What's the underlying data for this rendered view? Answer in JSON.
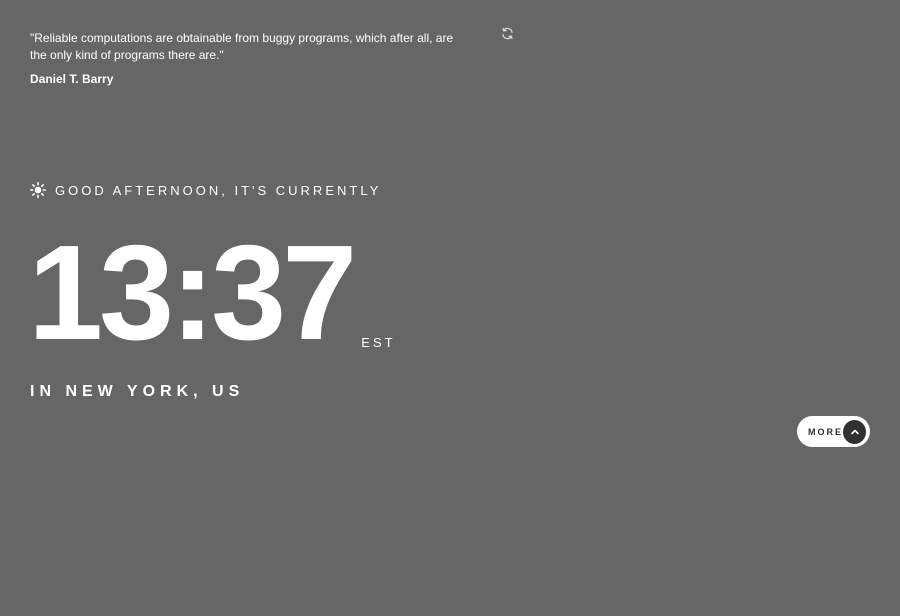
{
  "quote": {
    "text": "\"Reliable computations are obtainable from buggy programs, which after all, are the only kind of programs there are.\"",
    "author": "Daniel T. Barry",
    "refresh_icon": "refresh-icon"
  },
  "greeting": {
    "icon": "sun-icon",
    "text": "GOOD AFTERNOON, IT'S CURRENTLY"
  },
  "clock": {
    "time": "13:37",
    "timezone": "EST"
  },
  "location": {
    "text": "IN NEW YORK, US"
  },
  "more_button": {
    "label": "MORE",
    "icon": "chevron-up-icon"
  },
  "colors": {
    "background": "#666666",
    "text": "#ffffff",
    "button_bg": "#ffffff",
    "button_icon_bg": "#303030"
  }
}
